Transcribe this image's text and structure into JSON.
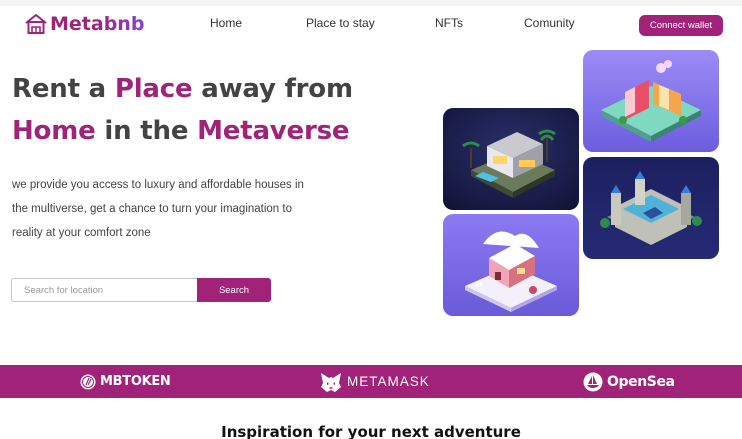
{
  "brand": {
    "logo_text": "Metabnb",
    "logo_icon": "house-icon",
    "accent_color": "#a02279"
  },
  "nav": {
    "links": [
      "Home",
      "Place to stay",
      "NFTs",
      "Comunity"
    ],
    "connect_wallet_label": "Connect wallet"
  },
  "hero": {
    "title_line1_a": "Rent a ",
    "title_line1_accent": "Place",
    "title_line1_b": " away from",
    "title_line2_accent": "Home",
    "title_line2_b": " in the ",
    "title_line2_accent2": "Metaverse",
    "description": "we provide you access to luxury and affordable houses in the multiverse, get a chance to turn your imagination to reality at your comfort zone",
    "search_placeholder": "Search for location",
    "search_value": "",
    "search_button_label": "Search"
  },
  "gallery": {
    "images": [
      "isometric-market-stalls",
      "isometric-modern-house",
      "isometric-castle",
      "isometric-snow-cabin"
    ]
  },
  "partners": {
    "items": [
      {
        "label": "MBTOKEN",
        "icon": "mbtoken-icon"
      },
      {
        "label": "METAMASK",
        "icon": "fox-icon"
      },
      {
        "label": "OpenSea",
        "icon": "sailboat-icon"
      }
    ]
  },
  "section": {
    "title": "Inspiration for your next adventure"
  }
}
